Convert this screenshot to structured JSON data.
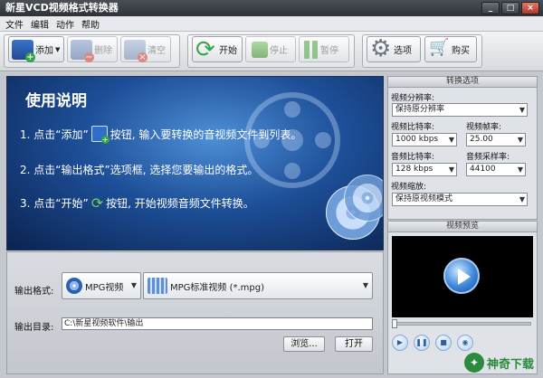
{
  "window": {
    "title": "新星VCD视频格式转换器"
  },
  "menu": [
    "文件",
    "编辑",
    "动作",
    "帮助"
  ],
  "toolbar": {
    "add": "添加",
    "delete": "删除",
    "clear": "清空",
    "start": "开始",
    "stop": "停止",
    "pause": "暂停",
    "options": "选项",
    "buy": "购买"
  },
  "guide": {
    "title": "使用说明",
    "step1_a": "1. 点击“添加”",
    "step1_b": "按钮, 输入要转换的音视频文件到列表。",
    "step2": "2. 点击“输出格式”选项框, 选择您要输出的格式。",
    "step3_a": "3. 点击“开始”",
    "step3_b": "按钮, 开始视频音频文件转换。"
  },
  "output": {
    "format_label": "输出格式:",
    "format_category": "MPG视频",
    "format_value": "MPG标准视频 (*.mpg)",
    "dir_label": "输出目录:",
    "dir_value": "C:\\新星视频软件\\输出",
    "browse": "浏览...",
    "open": "打开"
  },
  "settings": {
    "header": "转换选项",
    "resolution_label": "视频分辨率:",
    "resolution_value": "保持原分辨率",
    "vbitrate_label": "视频比特率:",
    "vbitrate_value": "1000 kbps",
    "framerate_label": "视频帧率:",
    "framerate_value": "25.00",
    "abitrate_label": "音频比特率:",
    "abitrate_value": "128 kbps",
    "samplerate_label": "音频采样率:",
    "samplerate_value": "44100",
    "scale_label": "视频缩放:",
    "scale_value": "保持原视频模式"
  },
  "preview": {
    "header": "视频预览"
  },
  "watermark": {
    "text": "神奇下载"
  },
  "colors": {
    "guide_bg": "#1d4f98",
    "accent_green": "#2b8a3e"
  }
}
